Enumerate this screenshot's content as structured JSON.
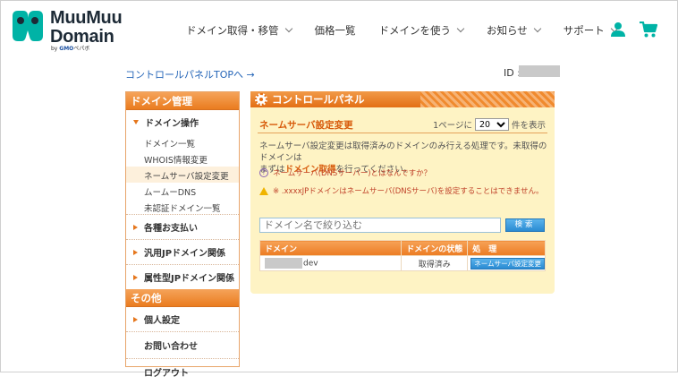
{
  "header": {
    "logo_line1": "MuuMuu",
    "logo_line2": "Domain",
    "logo_by_prefix": "by ",
    "logo_by_brand": "GMO",
    "logo_by_suffix": "ペパボ",
    "brand_color": "#00b3a6",
    "nav": [
      {
        "label": "ドメイン取得・移管",
        "icon": "chevron-down-icon"
      },
      {
        "label": "価格一覧"
      },
      {
        "label": "ドメインを使う",
        "icon": "chevron-down-icon"
      },
      {
        "label": "お知らせ",
        "icon": "chevron-down-icon"
      },
      {
        "label": "サポート",
        "icon": "chevron-down-icon"
      }
    ],
    "user_icon": "user-icon",
    "cart_icon": "cart-icon"
  },
  "top": {
    "panel_link": "コントロールパネルTOPへ →",
    "id_label": "ID :"
  },
  "sidebar": {
    "head1": "ドメイン管理",
    "group_domain": "ドメイン操作",
    "subitems": [
      "ドメイン一覧",
      "WHOIS情報変更",
      "ネームサーバ設定変更",
      "ムームーDNS",
      "未認証ドメイン一覧"
    ],
    "groups": [
      "各種お支払い",
      "汎用JPドメイン関係",
      "属性型JPドメイン関係"
    ],
    "head2": "その他",
    "group_personal": "個人設定",
    "contact": "お問い合わせ",
    "logout": "ログアウト"
  },
  "main": {
    "panel_title": "コントロールパネル",
    "section_title": "ネームサーバ設定変更",
    "perpage_prefix": "1ページに",
    "perpage_value": "20",
    "perpage_suffix": "件を表示",
    "desc_line1": "ネームサーバ設定変更は取得済みのドメインのみ行える処理です。未取得のドメインは",
    "desc_line2_pre": "まずは",
    "desc_line2_link": "ドメイン取得",
    "desc_line2_post": "を行ってください。",
    "faq": "ネームサーバ(DNSサーバー)とはなんですか？",
    "warning": "※ .xxxxJPドメインはネームサーバ(DNSサーバ)を設定することはできません。",
    "search_placeholder": "ドメイン名で絞り込む",
    "search_button": "検索",
    "table_headers": [
      "ドメイン",
      "ドメインの状態",
      "処　理"
    ],
    "rows": [
      {
        "domain": "dev",
        "status": "取得済み",
        "action": "ネームサーバ設定変更"
      }
    ]
  }
}
